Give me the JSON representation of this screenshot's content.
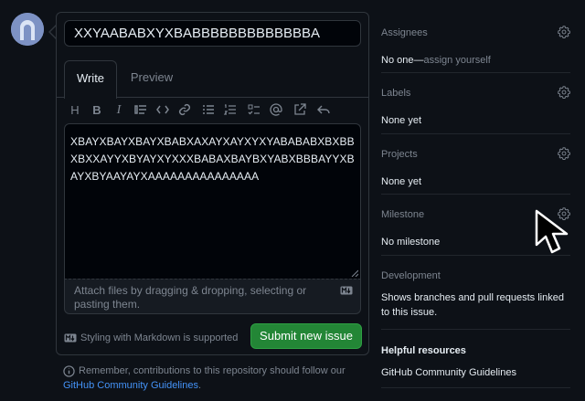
{
  "issue": {
    "title_value": "XXYAABABXYXBABBBBBBBBBBBBBA",
    "body_value": "XBAYXBAYXBAYXBABXAXAYXAYXYXYABABABXBXBBXBXXAYYXBYAYXYXXXBABAXBAYBXYABXBBBAYYXBAYXBYAAYAYXAAAAAAAAAAAAAAA"
  },
  "tabs": {
    "write": "Write",
    "preview": "Preview"
  },
  "toolbar": {
    "heading": "H",
    "bold": "B",
    "italic": "I"
  },
  "attach_text": "Attach files by dragging & dropping, selecting or pasting them.",
  "markdown_note": "Styling with Markdown is supported",
  "submit_label": "Submit new issue",
  "guidelines": {
    "text": "Remember, contributions to this repository should follow our",
    "link": "GitHub Community Guidelines",
    "tail": "."
  },
  "sidebar": {
    "assignees": {
      "title": "Assignees",
      "value_prefix": "No one—",
      "value_link": "assign yourself"
    },
    "labels": {
      "title": "Labels",
      "value": "None yet"
    },
    "projects": {
      "title": "Projects",
      "value": "None yet"
    },
    "milestone": {
      "title": "Milestone",
      "value": "No milestone"
    },
    "development": {
      "title": "Development",
      "value": "Shows branches and pull requests linked to this issue."
    },
    "helpful": {
      "title": "Helpful resources",
      "link": "GitHub Community Guidelines"
    }
  }
}
